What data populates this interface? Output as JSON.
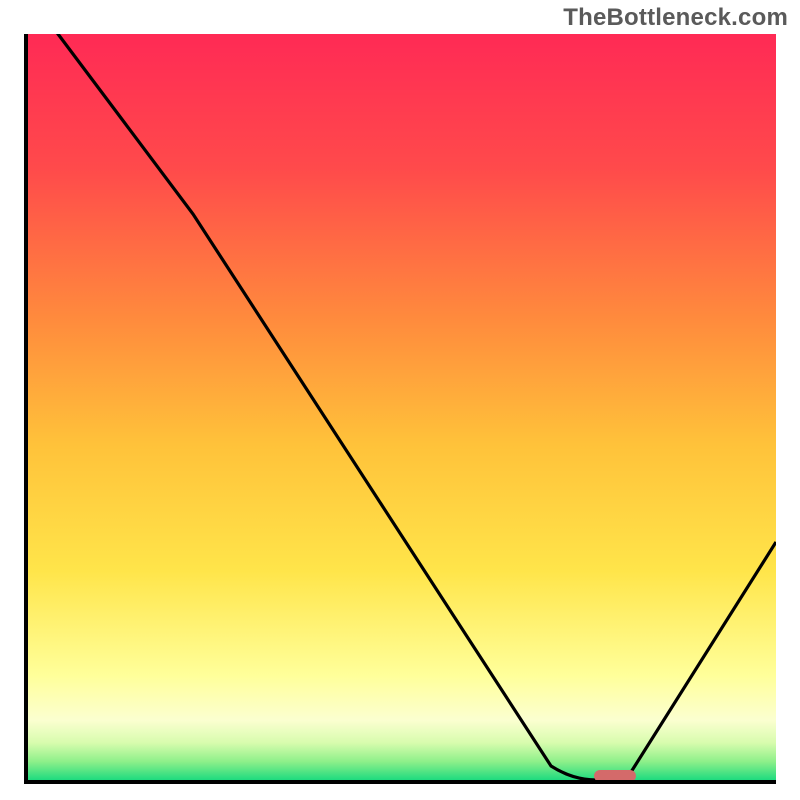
{
  "watermark": "TheBottleneck.com",
  "colors": {
    "top": "#ff2a55",
    "upper_mid": "#ff6a3d",
    "mid": "#ffb23a",
    "lower_mid": "#ffe54a",
    "pale": "#ffffb0",
    "near_bottom": "#b6f77a",
    "bottom": "#1edb7f",
    "curve": "#000000",
    "marker": "#d46a6a",
    "axis": "#000000"
  },
  "chart_data": {
    "type": "line",
    "title": "",
    "xlabel": "",
    "ylabel": "",
    "xlim": [
      0,
      100
    ],
    "ylim": [
      0,
      100
    ],
    "x": [
      0,
      4,
      22,
      70,
      76,
      80,
      100
    ],
    "values": [
      110,
      100,
      76,
      2,
      0,
      0,
      32
    ],
    "annotations": [
      {
        "kind": "marker",
        "x_start": 76,
        "x_end": 81,
        "y": 0
      }
    ],
    "description": "V-shaped bottleneck curve: high mismatch on the left descending steeply to a minimum near x≈78, then rising toward the right. Background is a vertical red→orange→yellow→green gradient indicating mismatch severity."
  }
}
